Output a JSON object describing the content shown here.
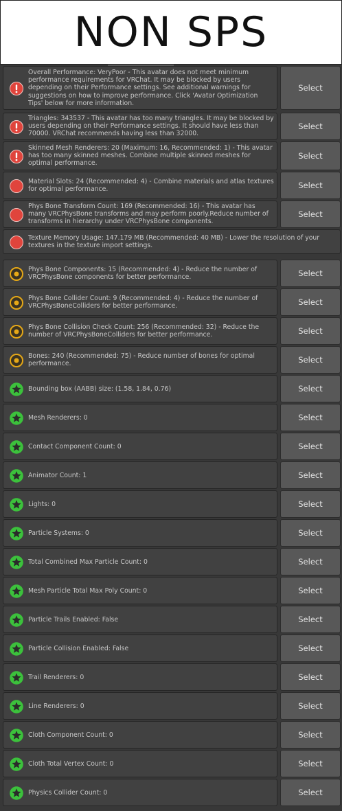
{
  "banner": {
    "title": "NON SPS"
  },
  "select_label": "Select",
  "colors": {
    "error": "#e0443c",
    "warning": "#e6a817",
    "good": "#3cc13c"
  },
  "items": [
    {
      "level": "error-exclaim",
      "icon": "exclamation-circle-icon",
      "text": "Overall Performance: VeryPoor - This avatar does not meet minimum performance requirements for VRChat. It may be blocked by users depending on their Performance settings. See additional warnings for suggestions on how to improve performance. Click 'Avatar Optimization Tips' below for more information.",
      "button": true
    },
    {
      "level": "error-exclaim",
      "icon": "exclamation-circle-icon",
      "text": "Triangles: 343537 - This avatar has too many triangles. It may be blocked by users depending on their Performance settings. It should have less than 70000. VRChat recommends having less than 32000.",
      "button": true
    },
    {
      "level": "error-exclaim",
      "icon": "exclamation-circle-icon",
      "text": "Skinned Mesh Renderers: 20 (Maximum: 16, Recommended: 1) - This avatar has too many skinned meshes. Combine multiple skinned meshes for optimal performance.",
      "button": true
    },
    {
      "level": "error",
      "icon": "red-circle-icon",
      "text": "Material Slots: 24 (Recommended: 4) - Combine materials and atlas textures for optimal performance.",
      "button": true
    },
    {
      "level": "error",
      "icon": "red-circle-icon",
      "text": "Phys Bone Transform Count: 169 (Recommended: 16) - This avatar has many VRCPhysBone transforms and may perform poorly.Reduce number of transforms in hierarchy under VRCPhysBone components.",
      "button": true
    },
    {
      "level": "error",
      "icon": "red-circle-icon",
      "text": "Texture Memory Usage: 147.179 MB (Recommended: 40 MB) - Lower the resolution of your textures in the texture import settings.",
      "button": false
    },
    {
      "level": "warning",
      "icon": "yellow-ring-icon",
      "text": "Phys Bone Components: 15 (Recommended: 4) - Reduce the number of VRCPhysBone components for better performance.",
      "button": true
    },
    {
      "level": "warning",
      "icon": "yellow-ring-icon",
      "text": "Phys Bone Collider Count: 9 (Recommended: 4) - Reduce the number of VRCPhysBoneColliders for better performance.",
      "button": true
    },
    {
      "level": "warning",
      "icon": "yellow-ring-icon",
      "text": "Phys Bone Collision Check Count: 256 (Recommended: 32) - Reduce the number of VRCPhysBoneColliders for better performance.",
      "button": true
    },
    {
      "level": "warning",
      "icon": "yellow-ring-icon",
      "text": "Bones: 240 (Recommended: 75) - Reduce number of bones for optimal performance.",
      "button": true
    },
    {
      "level": "good",
      "icon": "green-star-icon",
      "text": "Bounding box (AABB) size: (1.58, 1.84, 0.76)",
      "button": true
    },
    {
      "level": "good",
      "icon": "green-star-icon",
      "text": "Mesh Renderers: 0",
      "button": true
    },
    {
      "level": "good",
      "icon": "green-star-icon",
      "text": "Contact Component Count: 0",
      "button": true
    },
    {
      "level": "good",
      "icon": "green-star-icon",
      "text": "Animator Count: 1",
      "button": true
    },
    {
      "level": "good",
      "icon": "green-star-icon",
      "text": "Lights: 0",
      "button": true
    },
    {
      "level": "good",
      "icon": "green-star-icon",
      "text": "Particle Systems: 0",
      "button": true
    },
    {
      "level": "good",
      "icon": "green-star-icon",
      "text": "Total Combined Max Particle Count: 0",
      "button": true
    },
    {
      "level": "good",
      "icon": "green-star-icon",
      "text": "Mesh Particle Total Max Poly Count: 0",
      "button": true
    },
    {
      "level": "good",
      "icon": "green-star-icon",
      "text": "Particle Trails Enabled: False",
      "button": true
    },
    {
      "level": "good",
      "icon": "green-star-icon",
      "text": "Particle Collision Enabled: False",
      "button": true
    },
    {
      "level": "good",
      "icon": "green-star-icon",
      "text": "Trail Renderers: 0",
      "button": true
    },
    {
      "level": "good",
      "icon": "green-star-icon",
      "text": "Line Renderers: 0",
      "button": true
    },
    {
      "level": "good",
      "icon": "green-star-icon",
      "text": "Cloth Component Count: 0",
      "button": true
    },
    {
      "level": "good",
      "icon": "green-star-icon",
      "text": "Cloth Total Vertex Count: 0",
      "button": true
    },
    {
      "level": "good",
      "icon": "green-star-icon",
      "text": "Physics Collider Count: 0",
      "button": true
    }
  ]
}
